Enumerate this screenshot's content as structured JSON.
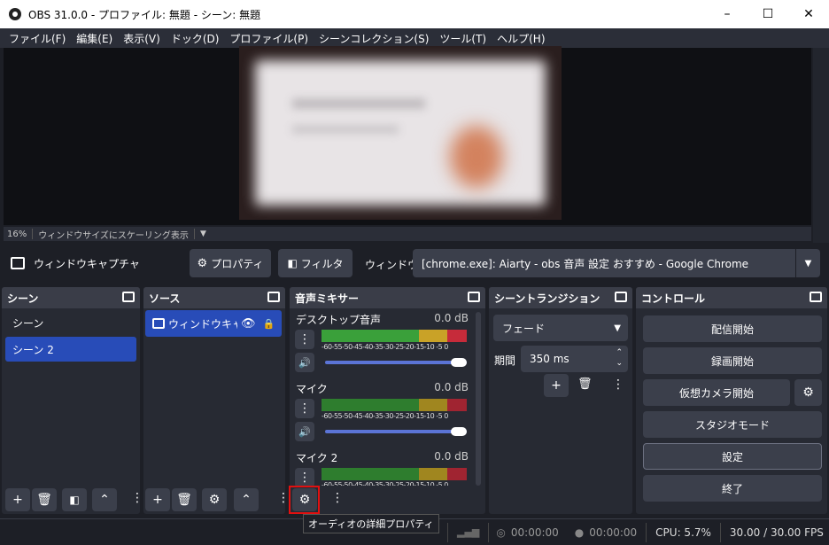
{
  "window": {
    "title": "OBS 31.0.0 - プロファイル: 無題 - シーン: 無題",
    "minimize": "–",
    "maximize": "☐",
    "close": "✕"
  },
  "menu": [
    "ファイル(F)",
    "編集(E)",
    "表示(V)",
    "ドック(D)",
    "プロファイル(P)",
    "シーンコレクション(S)",
    "ツール(T)",
    "ヘルプ(H)"
  ],
  "zoom": {
    "percent": "16%",
    "mode": "ウィンドウサイズにスケーリング表示"
  },
  "context": {
    "source_label": "ウィンドウキャプチャ",
    "properties_button": "プロパティ",
    "filter_button": "フィルタ",
    "window_label": "ウィンドウ",
    "window_value": "[chrome.exe]: Aiarty - obs 音声 設定 おすすめ - Google Chrome"
  },
  "scenes": {
    "title": "シーン",
    "items": [
      "シーン",
      "シーン 2"
    ],
    "selected": 1
  },
  "sources": {
    "title": "ソース",
    "items": [
      "ウィンドウキャプ"
    ]
  },
  "mixer": {
    "title": "音声ミキサー",
    "channels": [
      {
        "name": "デスクトップ音声",
        "db": "0.0 dB"
      },
      {
        "name": "マイク",
        "db": "0.0 dB"
      },
      {
        "name": "マイク 2",
        "db": "0.0 dB"
      }
    ],
    "ticks": "-60-55-50-45-40-35-30-25-20-15-10 -5  0",
    "advanced_tooltip": "オーディオの詳細プロパティ"
  },
  "transitions": {
    "title": "シーントランジション",
    "type": "フェード",
    "duration_label": "期間",
    "duration_value": "350 ms"
  },
  "controls": {
    "title": "コントロール",
    "buttons": [
      "配信開始",
      "録画開始",
      "仮想カメラ開始",
      "スタジオモード",
      "設定",
      "終了"
    ]
  },
  "status": {
    "stream_time": "00:00:00",
    "rec_time": "00:00:00",
    "cpu": "CPU: 5.7%",
    "fps": "30.00 / 30.00 FPS"
  },
  "colors": {
    "accent": "#284cb8",
    "highlight": "#e21010",
    "meter_green": "#3aa03a",
    "meter_yellow": "#c9a227",
    "meter_red": "#c62b3a"
  }
}
